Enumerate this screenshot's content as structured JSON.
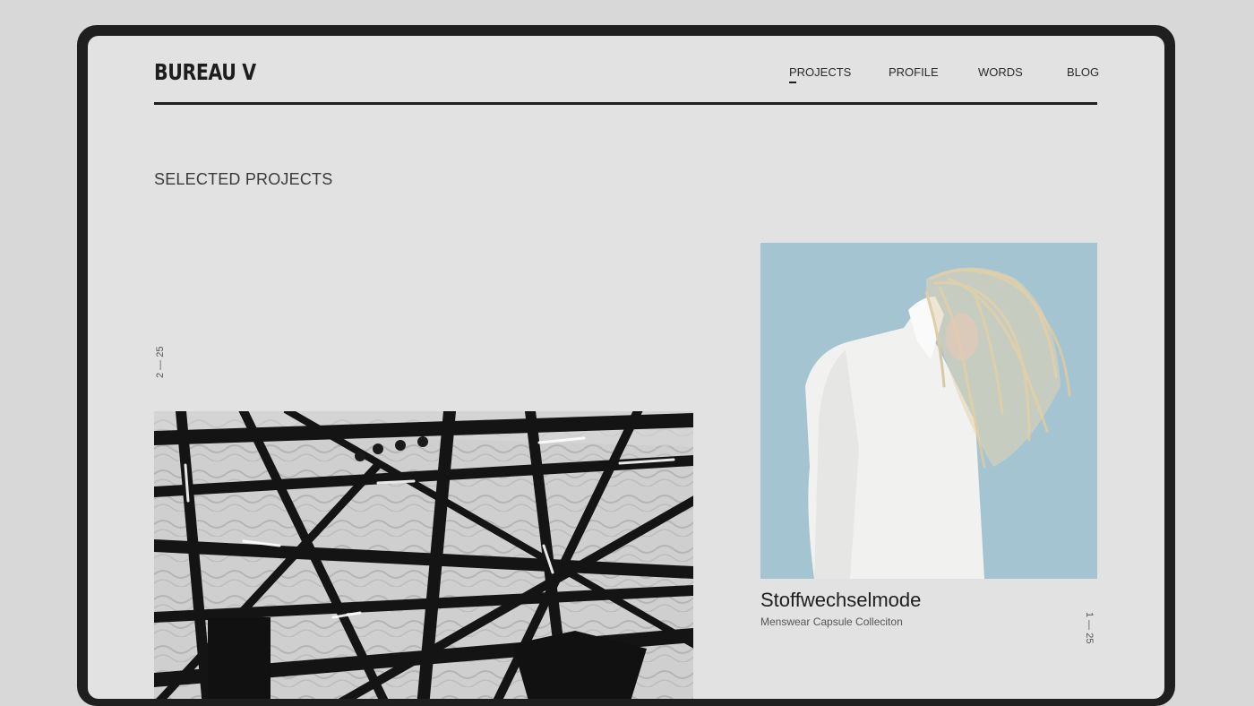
{
  "header": {
    "logo": "BUREAU V",
    "nav": [
      {
        "label": "PROJECTS",
        "active": true
      },
      {
        "label": "PROFILE"
      },
      {
        "label": "WORDS"
      },
      {
        "label": "BLOG"
      }
    ]
  },
  "main": {
    "section_title": "SELECTED PROJECTS",
    "projects": [
      {
        "counter": "2 — 25"
      },
      {
        "counter": "1 — 25",
        "title": "Stoffwechselmode",
        "subtitle": "Menswear Capsule Colleciton"
      }
    ]
  },
  "colors": {
    "page_bg": "#e2e2e2",
    "device_frame": "#1f1f1f",
    "text": "#1e1e1e",
    "photo_sky": "#a4c4d2"
  }
}
